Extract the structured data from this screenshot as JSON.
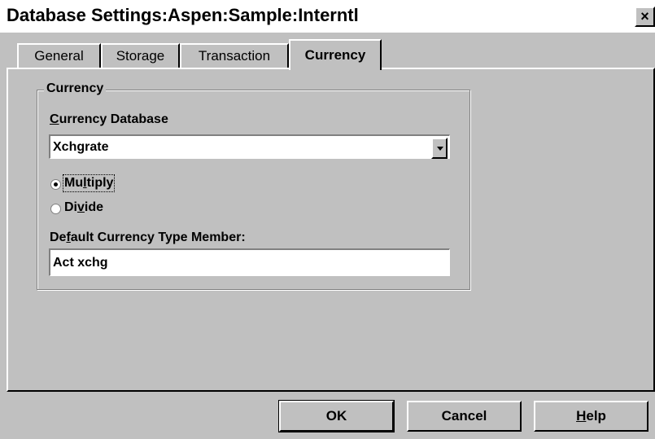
{
  "window": {
    "title": "Database Settings:Aspen:Sample:Interntl",
    "close_label": "×"
  },
  "tabs": [
    {
      "label": "General",
      "active": false
    },
    {
      "label": "Storage",
      "active": false
    },
    {
      "label": "Transaction",
      "active": false
    },
    {
      "label": "Currency",
      "active": true
    }
  ],
  "currency": {
    "group_label": "Currency",
    "database_label_ul": "C",
    "database_label_rest": "urrency Database",
    "database_value": "Xchgrate",
    "radio_multiply": {
      "pre": "Mu",
      "ul": "l",
      "post": "tiply",
      "checked": true
    },
    "radio_divide": {
      "pre": "Di",
      "ul": "v",
      "post": "ide",
      "checked": false
    },
    "default_label_pre": "De",
    "default_label_ul": "f",
    "default_label_post": "ault Currency Type Member:",
    "default_value": "Act xchg"
  },
  "buttons": {
    "ok": "OK",
    "cancel": "Cancel",
    "help_ul": "H",
    "help_rest": "elp"
  }
}
